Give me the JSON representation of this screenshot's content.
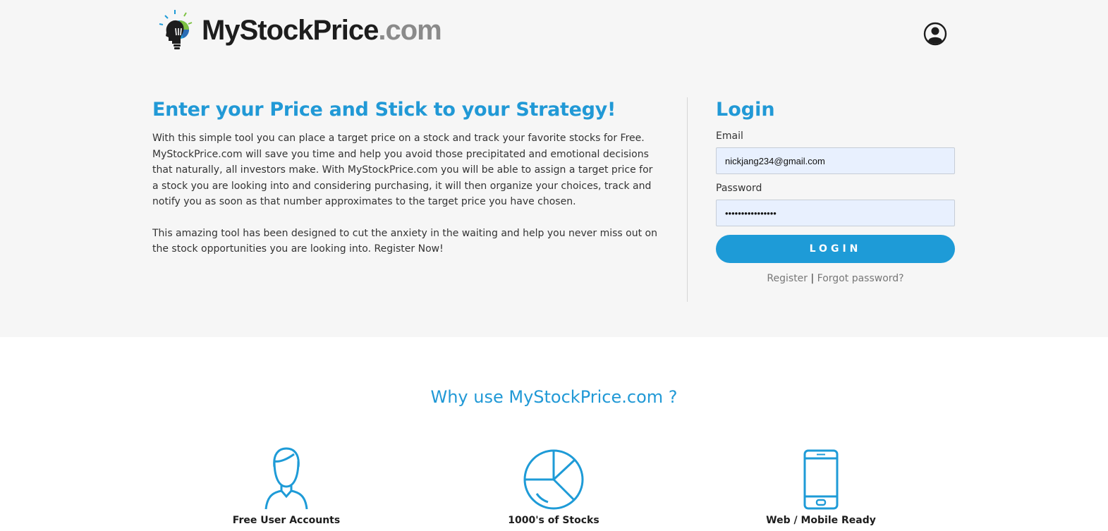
{
  "brand": {
    "name": "MyStockPrice",
    "tld": ".com"
  },
  "header": {
    "account_icon": "user-circle-icon"
  },
  "hero": {
    "headline": "Enter your Price and Stick to your Strategy!",
    "paragraph1": "With this simple tool you can place a target price on a stock and track your favorite stocks for Free. MyStockPrice.com will save you time and help you avoid those precipitated and emotional decisions that naturally, all investors make. With MyStockPrice.com you will be able to assign a target price for a stock you are looking into and considering purchasing, it will then organize your choices, track and notify you as soon as that number approximates to the target price you have chosen.",
    "paragraph2": "This amazing tool has been designed to cut the anxiety in the waiting and help you never miss out on the stock opportunities you are looking into. Register Now!"
  },
  "login": {
    "title": "Login",
    "email_label": "Email",
    "email_value": "nickjang234@gmail.com",
    "password_label": "Password",
    "password_value": "••••••••••••••••",
    "button_label": "LOGIN",
    "register_link": "Register",
    "separator": "|",
    "forgot_link": "Forgot password?"
  },
  "why": {
    "title": "Why use MyStockPrice.com ?",
    "features": [
      {
        "label": "Free User Accounts",
        "icon": "user-icon"
      },
      {
        "label": "1000's of Stocks",
        "icon": "pie-chart-icon"
      },
      {
        "label": "Web / Mobile Ready",
        "icon": "smartphone-icon"
      }
    ]
  },
  "colors": {
    "accent": "#1e9bd7",
    "background_top": "#f6f6f6",
    "input_fill": "#e8f0fe"
  }
}
